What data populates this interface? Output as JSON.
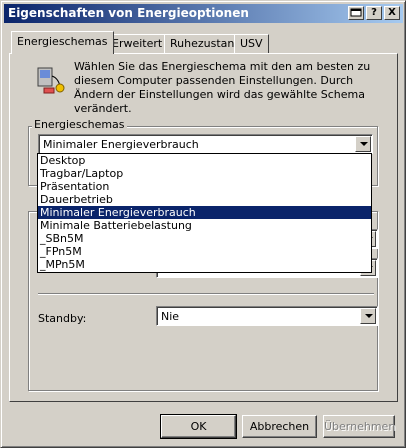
{
  "window": {
    "title": "Eigenschaften von Energieoptionen",
    "help_label": "?",
    "close_label": "X"
  },
  "tabs": [
    {
      "label": "Energieschemas",
      "active": true
    },
    {
      "label": "Erweitert",
      "active": false
    },
    {
      "label": "Ruhezustand",
      "active": false
    },
    {
      "label": "USV",
      "active": false
    }
  ],
  "intro_text": "Wählen Sie das Energieschema mit den am besten zu diesem Computer passenden Einstellungen. Durch Ändern der Einstellungen wird das gewählte Schema verändert.",
  "schemes": {
    "group_label": "Energieschemas",
    "selected": "Minimaler Energieverbrauch",
    "options": [
      "Desktop",
      "Tragbar/Laptop",
      "Präsentation",
      "Dauerbetrieb",
      "Minimaler Energieverbrauch",
      "Minimale Batteriebelastung",
      "_SBn5M",
      "_FPn5M",
      "_MPn5M"
    ],
    "selected_index": 4
  },
  "standby": {
    "label": "Standby:",
    "value": "Nie"
  },
  "buttons": {
    "ok": "OK",
    "cancel": "Abbrechen",
    "apply": "Übernehmen"
  }
}
